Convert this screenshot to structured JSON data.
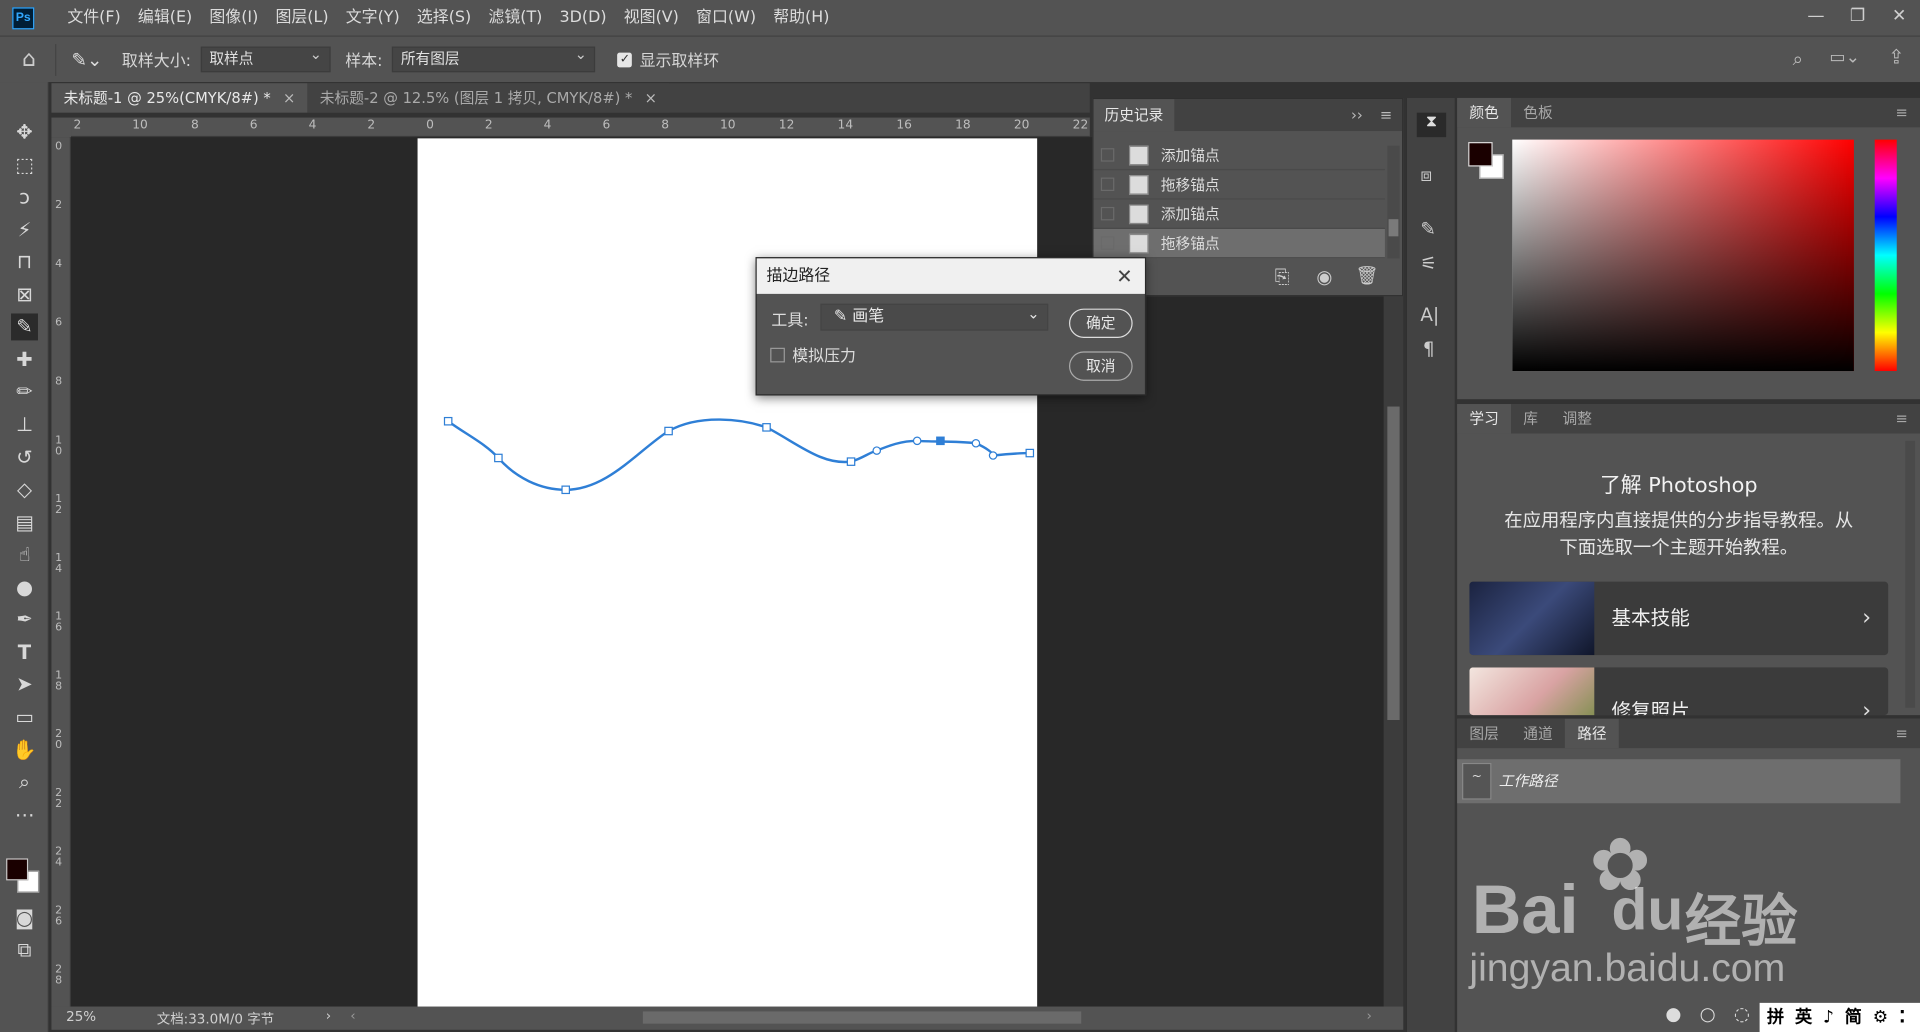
{
  "menubar": {
    "logo": "Ps",
    "items": [
      "文件(F)",
      "编辑(E)",
      "图像(I)",
      "图层(L)",
      "文字(Y)",
      "选择(S)",
      "滤镜(T)",
      "3D(D)",
      "视图(V)",
      "窗口(W)",
      "帮助(H)"
    ]
  },
  "options": {
    "sample_size_label": "取样大小:",
    "sample_size_value": "取样点",
    "sample_label": "样本:",
    "sample_value": "所有图层",
    "show_ring_label": "显示取样环"
  },
  "tabs": [
    {
      "label": "未标题-1 @ 25%(CMYK/8#) *",
      "close": "×"
    },
    {
      "label": "未标题-2 @ 12.5% (图层 1 拷贝, CMYK/8#) *",
      "close": "×"
    }
  ],
  "ruler_h": [
    "2",
    "10",
    "8",
    "6",
    "4",
    "2",
    "0",
    "2",
    "4",
    "6",
    "8",
    "10",
    "12",
    "14",
    "16",
    "18",
    "20",
    "22"
  ],
  "ruler_v": [
    "0",
    "2",
    "4",
    "6",
    "8",
    "1\n0",
    "1\n2",
    "1\n4",
    "1\n6",
    "1\n8",
    "2\n0",
    "2\n2",
    "2\n4",
    "2\n6",
    "2\n8"
  ],
  "status": {
    "zoom": "25%",
    "doc": "文档:33.0M/0 字节"
  },
  "history": {
    "title": "历史记录",
    "items": [
      "添加锚点",
      "拖移锚点",
      "添加锚点",
      "拖移锚点"
    ]
  },
  "dialog": {
    "title": "描边路径",
    "tool_label": "工具:",
    "tool_value": "画笔",
    "simulate_pressure": "模拟压力",
    "ok": "确定",
    "cancel": "取消"
  },
  "color_panel": {
    "tabs": [
      "颜色",
      "色板"
    ]
  },
  "learn_panel": {
    "tabs": [
      "学习",
      "库",
      "调整"
    ],
    "heading": "了解 Photoshop",
    "desc_line1": "在应用程序内直接提供的分步指导教程。从",
    "desc_line2": "下面选取一个主题开始教程。",
    "cards": [
      "基本技能",
      "修复照片"
    ]
  },
  "paths_panel": {
    "tabs": [
      "图层",
      "通道",
      "路径"
    ],
    "item": "工作路径"
  },
  "watermark": {
    "line1": "Bai",
    "line2": "du",
    "cn": "经验",
    "url": "jingyan.baidu.com"
  },
  "ime": {
    "text": "拼 英 ♪ 简 ⚙ ⁚"
  },
  "colors": {
    "panel": "#535353",
    "dark": "#424242",
    "canvas": "#282828",
    "path": "#2f7fd6",
    "fg_swatch": "#1a0000"
  }
}
